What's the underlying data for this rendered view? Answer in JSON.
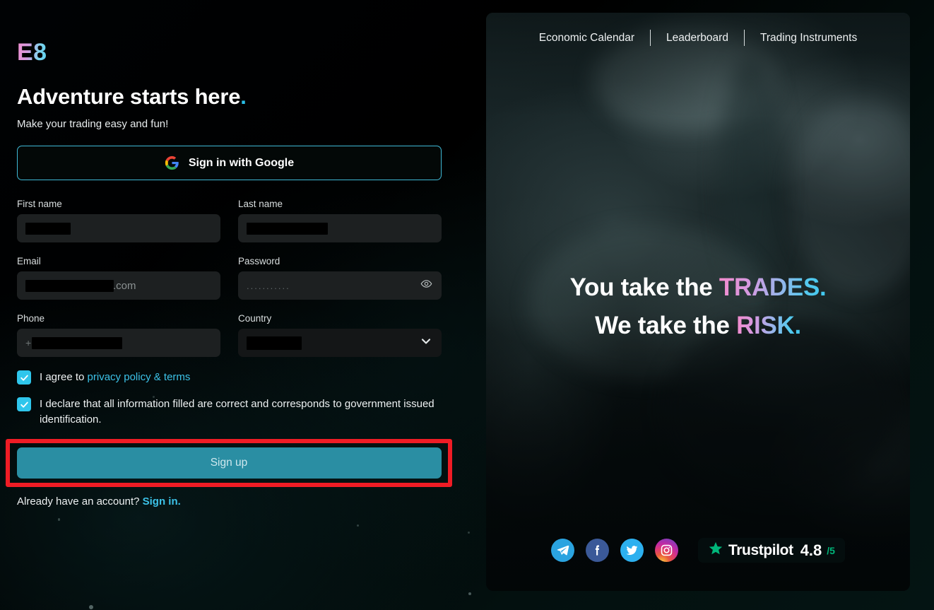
{
  "brand": {
    "logo": "E8"
  },
  "left": {
    "headline": "Adventure starts here",
    "headline_dot": ".",
    "subheadline": "Make your trading easy and fun!",
    "google_button": {
      "label": "Sign in with Google",
      "icon": "google-icon"
    },
    "fields": {
      "first_name": {
        "label": "First name",
        "value": "",
        "redacted": true,
        "redact_width": 64
      },
      "last_name": {
        "label": "Last name",
        "value": "",
        "redacted": true,
        "redact_width": 115
      },
      "email": {
        "label": "Email",
        "value": "",
        "redacted": true,
        "redact_width": 125,
        "visible_suffix": ".com"
      },
      "password": {
        "label": "Password",
        "value": "...........",
        "icon": "eye-icon"
      },
      "phone": {
        "label": "Phone",
        "value": "",
        "redacted": true,
        "redact_width": 128,
        "prefix": "+"
      },
      "country": {
        "label": "Country",
        "value": "",
        "redacted": true,
        "redact_width": 78,
        "icon": "chevron-down-icon"
      }
    },
    "consent": {
      "privacy_prefix": "I agree to ",
      "privacy_link": "privacy policy & terms",
      "declaration": "I declare that all information filled are correct and corresponds to government issued identification."
    },
    "signup_button": "Sign up",
    "footer_prefix": "Already have an account? ",
    "footer_link": "Sign in."
  },
  "hero": {
    "nav": [
      {
        "label": "Economic Calendar"
      },
      {
        "label": "Leaderboard"
      },
      {
        "label": "Trading Instruments"
      }
    ],
    "tagline": {
      "line1_plain": "You take the ",
      "line1_accent": "TRADES.",
      "line2_plain": "We take the ",
      "line2_accent": "RISK."
    },
    "socials": [
      {
        "name": "telegram-icon"
      },
      {
        "name": "facebook-icon"
      },
      {
        "name": "twitter-icon"
      },
      {
        "name": "instagram-icon"
      }
    ],
    "trustpilot": {
      "star": "trustpilot-star-icon",
      "name": "Trustpilot",
      "score": "4.8",
      "out_of": "/5"
    }
  },
  "colors": {
    "accent_cyan": "#29c0e8",
    "accent_pink": "#f58bcd",
    "signup_teal": "#2a8ea3",
    "highlight_red": "#ef1c25",
    "trustpilot_green": "#00b67a",
    "input_bg": "#1d2021"
  }
}
